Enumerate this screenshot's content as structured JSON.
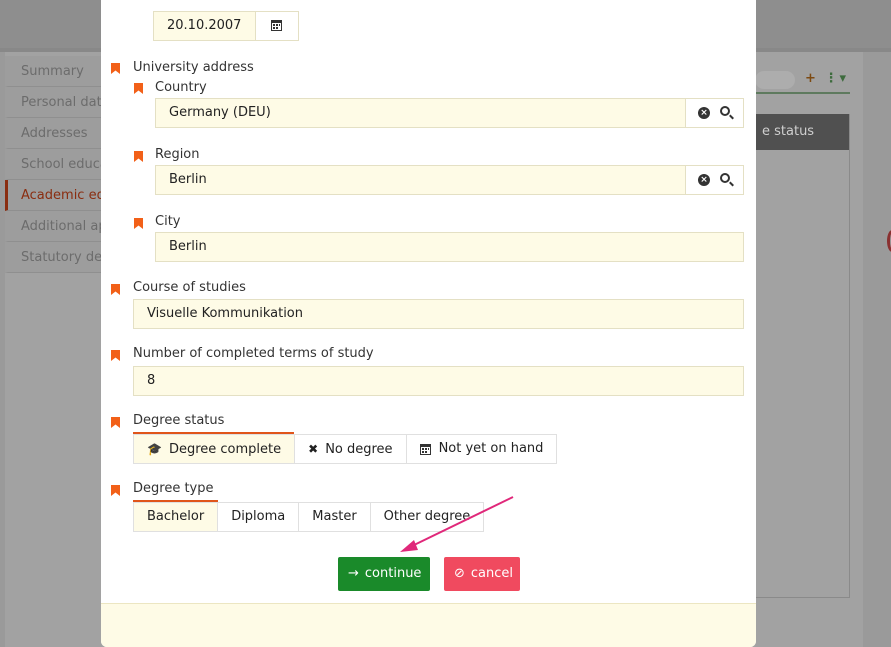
{
  "background": {
    "nav_items": [
      "Summary",
      "Personal dat",
      "Addresses",
      "School educa",
      "Academic ed",
      "Additional ap",
      "Statutory de"
    ],
    "active_index": 4,
    "table_header": "e status",
    "tools": {
      "add": "+",
      "more": "⋮▾"
    }
  },
  "form": {
    "date_value": "20.10.2007",
    "university_address_label": "University address",
    "country": {
      "label": "Country",
      "value": "Germany (DEU)"
    },
    "region": {
      "label": "Region",
      "value": "Berlin"
    },
    "city": {
      "label": "City",
      "value": "Berlin"
    },
    "course": {
      "label": "Course of studies",
      "value": "Visuelle Kommunikation"
    },
    "terms": {
      "label": "Number of completed terms of study",
      "value": "8"
    },
    "degree_status": {
      "label": "Degree status",
      "options": [
        {
          "label": "Degree complete",
          "icon": "graduation-cap-icon",
          "glyph": "🎓"
        },
        {
          "label": "No degree",
          "icon": "x-icon",
          "glyph": "✖"
        },
        {
          "label": "Not yet on hand",
          "icon": "calendar-icon",
          "glyph": ""
        }
      ],
      "selected": "Degree complete"
    },
    "degree_type": {
      "label": "Degree type",
      "options": [
        "Bachelor",
        "Diploma",
        "Master",
        "Other degree"
      ],
      "selected": "Bachelor"
    }
  },
  "actions": {
    "continue_label": "continue",
    "continue_icon": "→",
    "cancel_label": "cancel",
    "cancel_icon": "⊘"
  },
  "colors": {
    "accent": "#e0551a",
    "field_bg": "#fefbe6",
    "continue": "#1a8a2a",
    "cancel": "#f04a5f",
    "annotation_arrow": "#e0287a"
  }
}
